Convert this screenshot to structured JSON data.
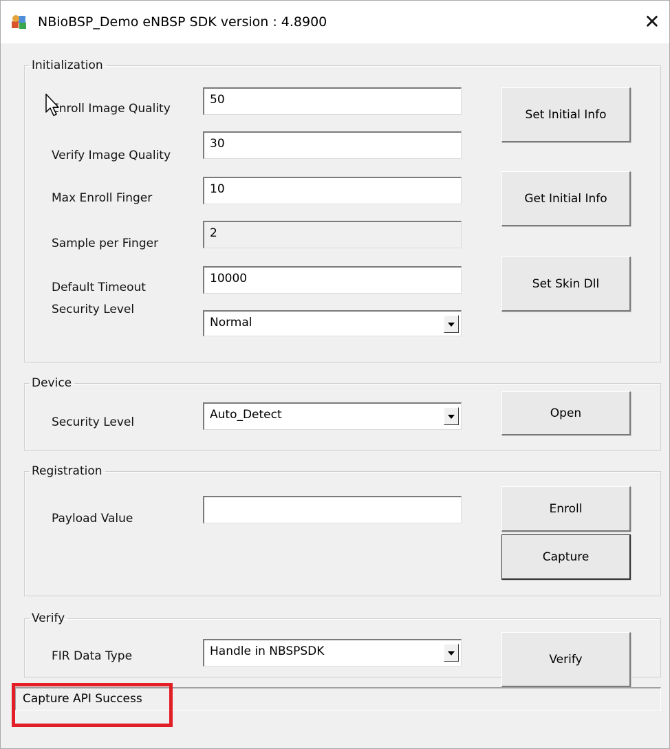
{
  "window": {
    "title": "NBioBSP_Demo eNBSP SDK version : 4.8900",
    "close_glyph": "✕"
  },
  "initialization": {
    "legend": "Initialization",
    "enroll_image_quality": {
      "label": "Enroll Image Quality",
      "value": "50"
    },
    "verify_image_quality": {
      "label": "Verify Image Quality",
      "value": "30"
    },
    "max_enroll_finger": {
      "label": "Max Enroll Finger",
      "value": "10"
    },
    "sample_per_finger": {
      "label": "Sample per Finger",
      "value": "2"
    },
    "default_timeout": {
      "label": "Default Timeout",
      "value": "10000"
    },
    "security_level": {
      "label": "Security Level",
      "value": "Normal"
    },
    "buttons": {
      "set_initial_info": "Set Initial Info",
      "get_initial_info": "Get Initial Info",
      "set_skin_dll": "Set Skin Dll"
    }
  },
  "device": {
    "legend": "Device",
    "security_level": {
      "label": "Security Level",
      "value": "Auto_Detect"
    },
    "open_button": "Open"
  },
  "registration": {
    "legend": "Registration",
    "payload": {
      "label": "Payload Value",
      "value": ""
    },
    "enroll_button": "Enroll",
    "capture_button": "Capture"
  },
  "verify": {
    "legend": "Verify",
    "fir_data_type": {
      "label": "FIR Data Type",
      "value": "Handle in NBSPSDK"
    },
    "verify_button": "Verify"
  },
  "status_bar": {
    "text": "Capture API Success"
  },
  "colors": {
    "highlight_border": "#e21f26",
    "window_bg": "#f0f0f0"
  },
  "icons": {
    "app": "app-icon",
    "close": "close-icon",
    "cursor": "mouse-pointer-icon",
    "dropdown": "chevron-down-icon"
  }
}
